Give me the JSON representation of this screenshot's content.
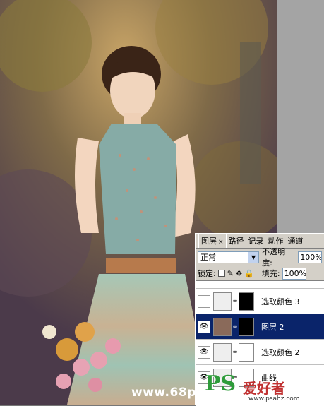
{
  "layers_panel": {
    "tabs": [
      {
        "label": "图层",
        "active": true,
        "close": "×"
      },
      {
        "label": "路径",
        "active": false
      },
      {
        "label": "记录",
        "active": false
      },
      {
        "label": "动作",
        "active": false
      },
      {
        "label": "通道",
        "active": false
      }
    ],
    "blend_mode": "正常",
    "opacity_label": "不透明度:",
    "opacity_value": "100%",
    "lock_label": "锁定:",
    "fill_label": "填充:",
    "fill_value": "100%",
    "layers": [
      {
        "name": "选取颜色 3",
        "selected": false,
        "visible": false
      },
      {
        "name": "图层 2",
        "selected": true,
        "visible": true
      },
      {
        "name": "选取颜色 2",
        "selected": false,
        "visible": true
      },
      {
        "name": "曲线",
        "selected": false,
        "visible": true
      }
    ]
  },
  "watermark": {
    "logo": "PS",
    "brand": "爱好者",
    "url": "www.psahz.com",
    "site": "www.68ps.com"
  },
  "colors": {
    "panel_bg": "#d4d0c8",
    "selected_layer": "#0a246a",
    "watermark_green": "#2e9b3a",
    "watermark_red": "#c03030"
  }
}
